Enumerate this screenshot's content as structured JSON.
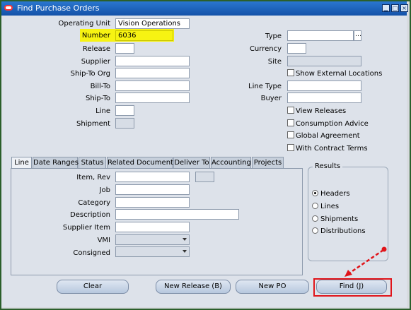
{
  "window": {
    "title": "Find Purchase Orders",
    "minimize_glyph": "▁",
    "maximize_glyph": "□",
    "close_glyph": "×"
  },
  "header": {
    "operating_unit_label": "Operating Unit",
    "operating_unit_value": "Vision Operations",
    "number_label": "Number",
    "number_value": "6036",
    "release_label": "Release",
    "supplier_label": "Supplier",
    "ship_to_org_label": "Ship-To Org",
    "bill_to_label": "Bill-To",
    "ship_to_label": "Ship-To",
    "line_label": "Line",
    "shipment_label": "Shipment",
    "type_label": "Type",
    "currency_label": "Currency",
    "site_label": "Site",
    "line_type_label": "Line Type",
    "buyer_label": "Buyer",
    "ellipsis": "…"
  },
  "checkboxes": {
    "show_external_locations": "Show External Locations",
    "view_releases": "View Releases",
    "consumption_advice": "Consumption Advice",
    "global_agreement": "Global Agreement",
    "with_contract_terms": "With Contract Terms"
  },
  "tabs": [
    "Line",
    "Date Ranges",
    "Status",
    "Related Documents",
    "Deliver To",
    "Accounting",
    "Projects"
  ],
  "line_tab": {
    "item_rev_label": "Item, Rev",
    "job_label": "Job",
    "category_label": "Category",
    "description_label": "Description",
    "supplier_item_label": "Supplier Item",
    "vmi_label": "VMI",
    "consigned_label": "Consigned"
  },
  "results": {
    "title": "Results",
    "options": [
      "Headers",
      "Lines",
      "Shipments",
      "Distributions"
    ],
    "selected": "Headers"
  },
  "buttons": {
    "clear": "Clear",
    "new_release": "New Release (B)",
    "new_po": "New PO",
    "find": "Find (J)"
  },
  "colors": {
    "highlight": "#f7f312",
    "find_box": "#e0141a",
    "arrow": "#e0141a"
  }
}
